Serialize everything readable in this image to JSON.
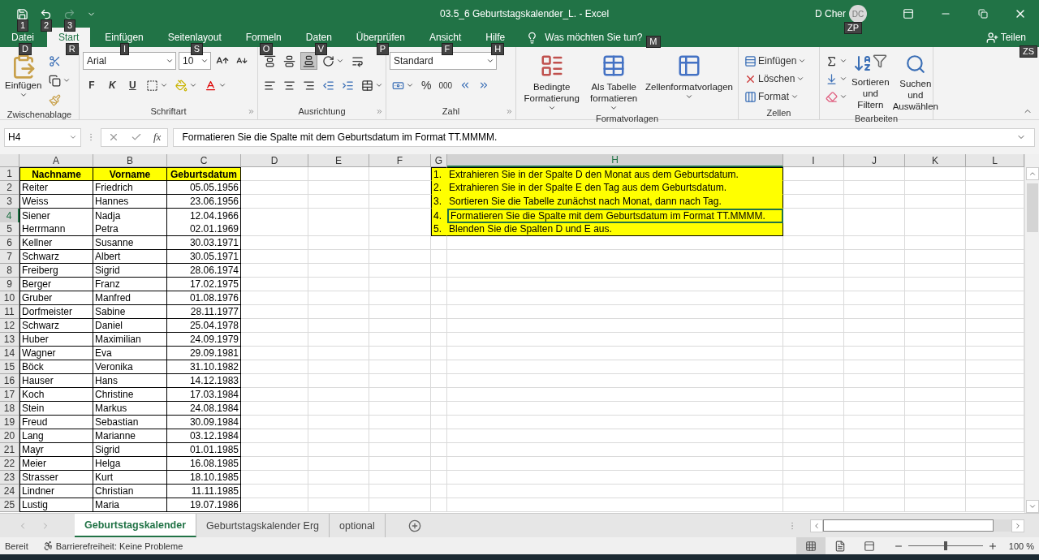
{
  "title_bar": {
    "quick_access": [
      {
        "kind": "save",
        "keytip": "1"
      },
      {
        "kind": "undo",
        "keytip": "2"
      },
      {
        "kind": "redo",
        "keytip": "3"
      },
      {
        "kind": "customize"
      }
    ],
    "title": "03.5_6 Geburtstagskalender_L.  -  Excel",
    "user": "D Cher",
    "avatar": "DC",
    "avatar_keytip": "ZP"
  },
  "tabs": [
    {
      "label": "Datei",
      "selected": false,
      "keytip": "D"
    },
    {
      "label": "Start",
      "selected": true,
      "keytip": "R"
    },
    {
      "label": "Einfügen",
      "selected": false,
      "keytip": "I"
    },
    {
      "label": "Seitenlayout",
      "selected": false,
      "keytip": "S"
    },
    {
      "label": "Formeln",
      "selected": false,
      "keytip": "O"
    },
    {
      "label": "Daten",
      "selected": false,
      "keytip": "V"
    },
    {
      "label": "Überprüfen",
      "selected": false,
      "keytip": "P"
    },
    {
      "label": "Ansicht",
      "selected": false,
      "keytip": "F"
    },
    {
      "label": "Hilfe",
      "selected": false,
      "keytip": "H"
    }
  ],
  "tell_me": {
    "text": "Was möchten Sie tun?",
    "keytip": "M"
  },
  "share": {
    "label": "Teilen",
    "keytip": "ZS"
  },
  "ribbon": {
    "clipboard": {
      "paste": "Einfügen",
      "label": "Zwischenablage"
    },
    "font": {
      "name": "Arial",
      "size": "10",
      "styles": [
        "F",
        "K",
        "U"
      ],
      "label": "Schriftart"
    },
    "alignment": {
      "vertical": [
        {
          "selected": false
        },
        {
          "selected": false
        },
        {
          "selected": true
        }
      ],
      "label": "Ausrichtung"
    },
    "number": {
      "format": "Standard",
      "percent": "%",
      "thousands": "000",
      "label": "Zahl"
    },
    "styles": {
      "buttons": [
        "Bedingte Formatierung",
        "Als Tabelle formatieren",
        "Zellenformatvorlagen"
      ],
      "label": "Formatvorlagen"
    },
    "cells": {
      "buttons": [
        "Einfügen",
        "Löschen",
        "Format"
      ],
      "label": "Zellen"
    },
    "editing": {
      "buttons": [
        "Sortieren und Filtern",
        "Suchen und Auswählen"
      ],
      "label": "Bearbeiten"
    }
  },
  "formula_bar": {
    "name_box": "H4",
    "fx": "fx",
    "content": "Formatieren Sie die Spalte mit dem Geburtsdatum im Format TT.MMMM."
  },
  "sheet": {
    "columns": [
      {
        "letter": "A",
        "selected": false
      },
      {
        "letter": "B",
        "selected": false
      },
      {
        "letter": "C",
        "selected": false
      },
      {
        "letter": "D",
        "selected": false
      },
      {
        "letter": "E",
        "selected": false
      },
      {
        "letter": "F",
        "selected": false
      },
      {
        "letter": "G",
        "selected": false
      },
      {
        "letter": "H",
        "selected": true
      },
      {
        "letter": "I",
        "selected": false
      },
      {
        "letter": "J",
        "selected": false
      },
      {
        "letter": "K",
        "selected": false
      },
      {
        "letter": "L",
        "selected": false
      }
    ],
    "rows": [
      {
        "number": "1",
        "selected": false,
        "kind": "header",
        "cells": [
          "Nachname",
          "Vorname",
          "Geburtsdatum"
        ]
      },
      {
        "number": "2",
        "selected": false,
        "kind": "data",
        "cells": [
          "Reiter",
          "Friedrich",
          "05.05.1956"
        ]
      },
      {
        "number": "3",
        "selected": false,
        "kind": "data",
        "cells": [
          "Weiss",
          "Hannes",
          "23.06.1956"
        ]
      },
      {
        "number": "4",
        "selected": true,
        "kind": "data",
        "cells": [
          "Siener",
          "Nadja",
          "12.04.1966"
        ]
      },
      {
        "number": "5",
        "selected": false,
        "kind": "data",
        "cells": [
          "Herrmann",
          "Petra",
          "02.01.1969"
        ]
      },
      {
        "number": "6",
        "selected": false,
        "kind": "data",
        "cells": [
          "Kellner",
          "Susanne",
          "30.03.1971"
        ]
      },
      {
        "number": "7",
        "selected": false,
        "kind": "data",
        "cells": [
          "Schwarz",
          "Albert",
          "30.05.1971"
        ]
      },
      {
        "number": "8",
        "selected": false,
        "kind": "data",
        "cells": [
          "Freiberg",
          "Sigrid",
          "28.06.1974"
        ]
      },
      {
        "number": "9",
        "selected": false,
        "kind": "data",
        "cells": [
          "Berger",
          "Franz",
          "17.02.1975"
        ]
      },
      {
        "number": "10",
        "selected": false,
        "kind": "data",
        "cells": [
          "Gruber",
          "Manfred",
          "01.08.1976"
        ]
      },
      {
        "number": "11",
        "selected": false,
        "kind": "data",
        "cells": [
          "Dorfmeister",
          "Sabine",
          "28.11.1977"
        ]
      },
      {
        "number": "12",
        "selected": false,
        "kind": "data",
        "cells": [
          "Schwarz",
          "Daniel",
          "25.04.1978"
        ]
      },
      {
        "number": "13",
        "selected": false,
        "kind": "data",
        "cells": [
          "Huber",
          "Maximilian",
          "24.09.1979"
        ]
      },
      {
        "number": "14",
        "selected": false,
        "kind": "data",
        "cells": [
          "Wagner",
          "Eva",
          "29.09.1981"
        ]
      },
      {
        "number": "15",
        "selected": false,
        "kind": "data",
        "cells": [
          "Böck",
          "Veronika",
          "31.10.1982"
        ]
      },
      {
        "number": "16",
        "selected": false,
        "kind": "data",
        "cells": [
          "Hauser",
          "Hans",
          "14.12.1983"
        ]
      },
      {
        "number": "17",
        "selected": false,
        "kind": "data",
        "cells": [
          "Koch",
          "Christine",
          "17.03.1984"
        ]
      },
      {
        "number": "18",
        "selected": false,
        "kind": "data",
        "cells": [
          "Stein",
          "Markus",
          "24.08.1984"
        ]
      },
      {
        "number": "19",
        "selected": false,
        "kind": "data",
        "cells": [
          "Freud",
          "Sebastian",
          "30.09.1984"
        ]
      },
      {
        "number": "20",
        "selected": false,
        "kind": "data",
        "cells": [
          "Lang",
          "Marianne",
          "03.12.1984"
        ]
      },
      {
        "number": "21",
        "selected": false,
        "kind": "data",
        "cells": [
          "Mayr",
          "Sigrid",
          "01.01.1985"
        ]
      },
      {
        "number": "22",
        "selected": false,
        "kind": "data",
        "cells": [
          "Meier",
          "Helga",
          "16.08.1985"
        ]
      },
      {
        "number": "23",
        "selected": false,
        "kind": "data",
        "cells": [
          "Strasser",
          "Kurt",
          "18.10.1985"
        ]
      },
      {
        "number": "24",
        "selected": false,
        "kind": "data",
        "cells": [
          "Lindner",
          "Christian",
          "11.11.1985"
        ]
      },
      {
        "number": "25",
        "selected": false,
        "kind": "data",
        "cells": [
          "Lustig",
          "Maria",
          "19.07.1986"
        ]
      }
    ],
    "instructions": [
      {
        "number": "1.",
        "text": "Extrahieren Sie in der Spalte D den Monat aus dem Geburtsdatum.",
        "selected": false
      },
      {
        "number": "2.",
        "text": "Extrahieren Sie in der Spalte E den Tag aus dem Geburtsdatum.",
        "selected": false
      },
      {
        "number": "3.",
        "text": "Sortieren Sie die Tabelle zunächst nach Monat, dann nach Tag.",
        "selected": false
      },
      {
        "number": "4.",
        "text": "Formatieren Sie die Spalte mit dem Geburtsdatum im Format TT.MMMM.",
        "selected": true
      },
      {
        "number": "5.",
        "text": "Blenden Sie die Spalten D und E aus.",
        "selected": false
      }
    ]
  },
  "sheet_tabs": [
    {
      "label": "Geburtstagskalender",
      "selected": true
    },
    {
      "label": "Geburtstagskalender Erg",
      "selected": false
    },
    {
      "label": "optional",
      "selected": false
    }
  ],
  "status_bar": {
    "mode": "Bereit",
    "accessibility": "Barrierefreiheit: Keine Probleme",
    "views": [
      {
        "kind": "normal",
        "selected": true
      },
      {
        "kind": "page_layout",
        "selected": false
      },
      {
        "kind": "page_break",
        "selected": false
      }
    ],
    "zoom": {
      "level": 0.5,
      "reading": "100 %"
    }
  }
}
